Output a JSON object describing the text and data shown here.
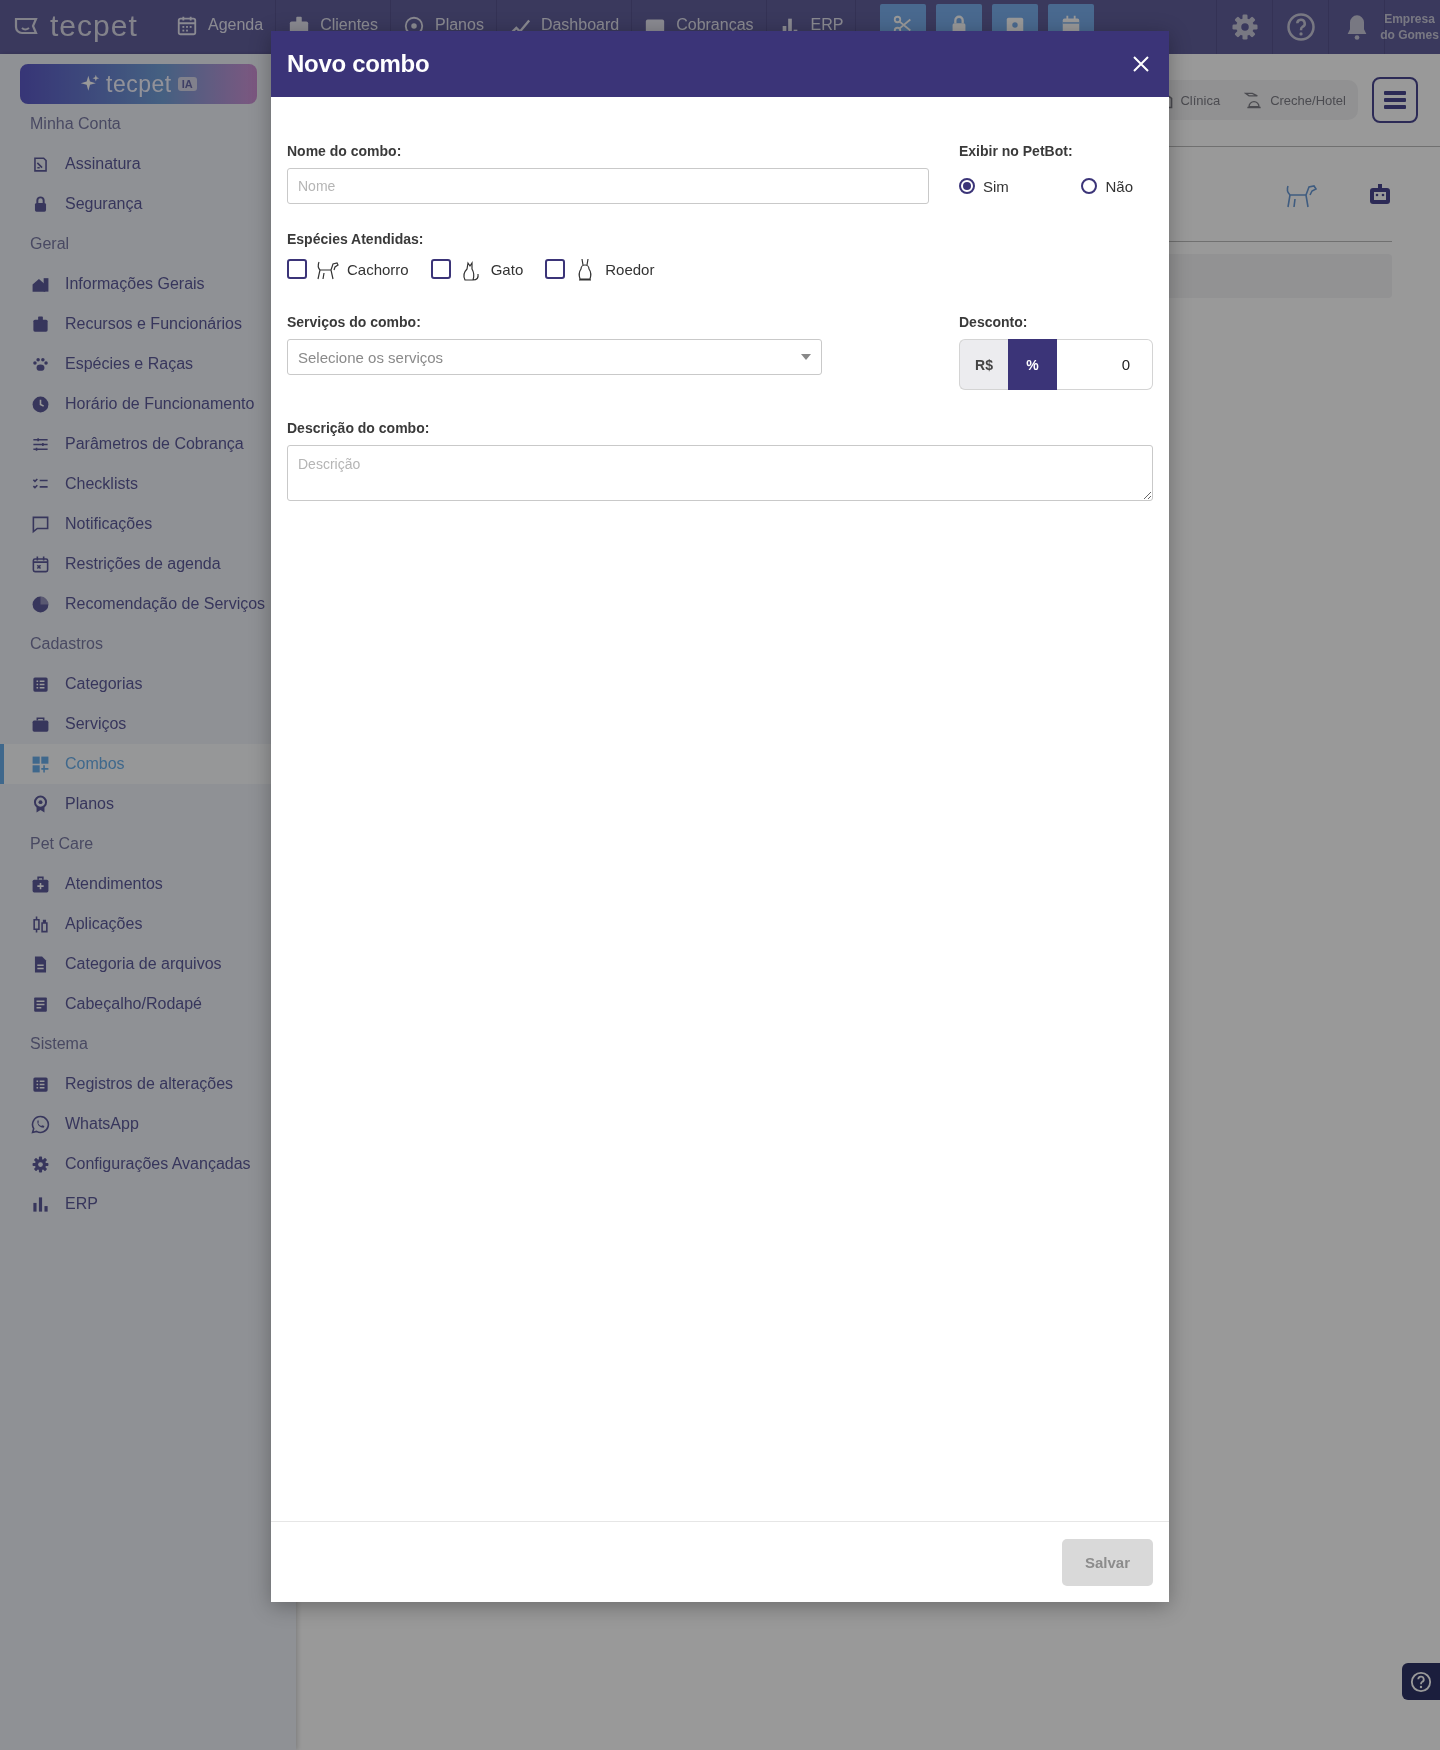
{
  "topbar": {
    "logo": "tecpet",
    "nav": [
      {
        "label": "Agenda"
      },
      {
        "label": "Clientes"
      },
      {
        "label": "Planos"
      },
      {
        "label": "Dashboard"
      },
      {
        "label": "Cobranças"
      },
      {
        "label": "ERP"
      }
    ],
    "account": "Empresa do Gomes"
  },
  "sidebar": {
    "banner": {
      "brand": "tecpet",
      "badge": "IA"
    },
    "sections": [
      {
        "title": "Minha Conta",
        "items": [
          {
            "label": "Assinatura",
            "selected": false
          },
          {
            "label": "Segurança",
            "selected": false
          }
        ]
      },
      {
        "title": "Geral",
        "items": [
          {
            "label": "Informações Gerais",
            "selected": false
          },
          {
            "label": "Recursos e Funcionários",
            "selected": false
          },
          {
            "label": "Espécies e Raças",
            "selected": false
          },
          {
            "label": "Horário de Funcionamento",
            "selected": false
          },
          {
            "label": "Parâmetros de Cobrança",
            "selected": false
          },
          {
            "label": "Checklists",
            "selected": false
          },
          {
            "label": "Notificações",
            "selected": false
          },
          {
            "label": "Restrições de agenda",
            "selected": false
          },
          {
            "label": "Recomendação de Serviços",
            "selected": false
          }
        ]
      },
      {
        "title": "Cadastros",
        "items": [
          {
            "label": "Categorias",
            "selected": false
          },
          {
            "label": "Serviços",
            "selected": false
          },
          {
            "label": "Combos",
            "selected": true
          },
          {
            "label": "Planos",
            "selected": false
          }
        ]
      },
      {
        "title": "Pet Care",
        "items": [
          {
            "label": "Atendimentos",
            "selected": false
          },
          {
            "label": "Aplicações",
            "selected": false
          },
          {
            "label": "Categoria de arquivos",
            "selected": false
          },
          {
            "label": "Cabeçalho/Rodapé",
            "selected": false
          }
        ]
      },
      {
        "title": "Sistema",
        "items": [
          {
            "label": "Registros de alterações",
            "selected": false
          },
          {
            "label": "WhatsApp",
            "selected": false
          },
          {
            "label": "Configurações Avançadas",
            "selected": false
          },
          {
            "label": "ERP",
            "selected": false
          }
        ]
      }
    ]
  },
  "background": {
    "modes": [
      "Clínica",
      "Creche/Hotel"
    ]
  },
  "modal": {
    "title": "Novo combo",
    "name_field": {
      "label": "Nome do combo:",
      "placeholder": "Nome"
    },
    "petbot": {
      "label": "Exibir no PetBot:",
      "options": [
        {
          "label": "Sim",
          "selected": true
        },
        {
          "label": "Não",
          "selected": false
        }
      ]
    },
    "species": {
      "label": "Espécies Atendidas:",
      "options": [
        {
          "label": "Cachorro",
          "checked": false
        },
        {
          "label": "Gato",
          "checked": false
        },
        {
          "label": "Roedor",
          "checked": false
        }
      ]
    },
    "services": {
      "label": "Serviços do combo:",
      "placeholder": "Selecione os serviços"
    },
    "discount": {
      "label": "Desconto:",
      "units": [
        {
          "label": "R$",
          "selected": false
        },
        {
          "label": "%",
          "selected": true
        }
      ],
      "value": "0"
    },
    "description": {
      "label": "Descrição do combo:",
      "placeholder": "Descrição"
    },
    "save_button": {
      "label": "Salvar",
      "disabled": true
    }
  }
}
